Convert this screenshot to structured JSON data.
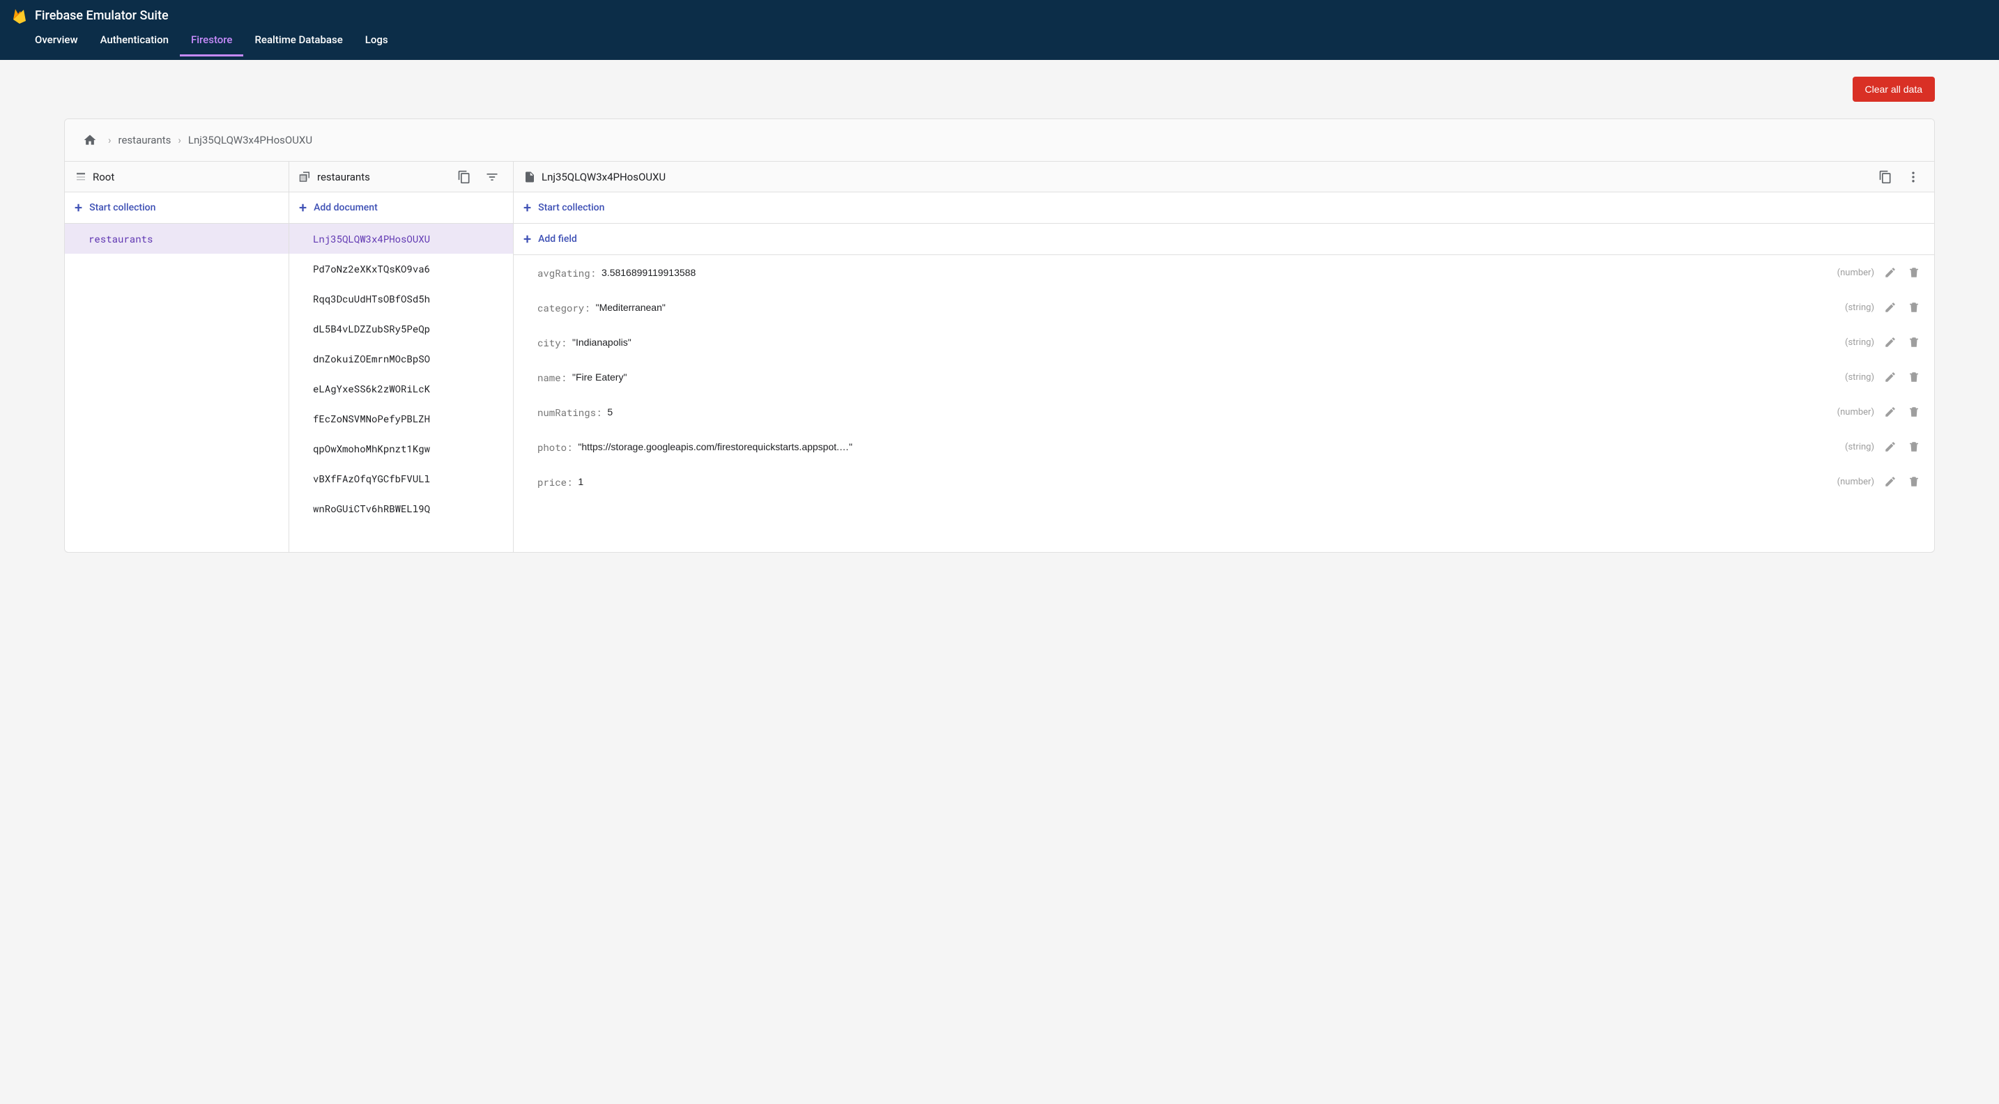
{
  "header": {
    "title": "Firebase Emulator Suite",
    "tabs": [
      {
        "label": "Overview",
        "active": false
      },
      {
        "label": "Authentication",
        "active": false
      },
      {
        "label": "Firestore",
        "active": true
      },
      {
        "label": "Realtime Database",
        "active": false
      },
      {
        "label": "Logs",
        "active": false
      }
    ]
  },
  "clear_button_label": "Clear all data",
  "breadcrumb": {
    "segments": [
      "restaurants",
      "Lnj35QLQW3x4PHosOUXU"
    ]
  },
  "columns": {
    "root": {
      "title": "Root",
      "action": "Start collection",
      "items": [
        {
          "id": "restaurants",
          "selected": true
        }
      ]
    },
    "collection": {
      "title": "restaurants",
      "action": "Add document",
      "items": [
        {
          "id": "Lnj35QLQW3x4PHosOUXU",
          "selected": true
        },
        {
          "id": "Pd7oNz2eXKxTQsKO9va6",
          "selected": false
        },
        {
          "id": "Rqq3DcuUdHTsOBfOSd5h",
          "selected": false
        },
        {
          "id": "dL5B4vLDZZubSRy5PeQp",
          "selected": false
        },
        {
          "id": "dnZokuiZOEmrnMOcBpSO",
          "selected": false
        },
        {
          "id": "eLAgYxeSS6k2zWORiLcK",
          "selected": false
        },
        {
          "id": "fEcZoNSVMNoPefyPBLZH",
          "selected": false
        },
        {
          "id": "qpOwXmohoMhKpnzt1Kgw",
          "selected": false
        },
        {
          "id": "vBXfFAzOfqYGCfbFVULl",
          "selected": false
        },
        {
          "id": "wnRoGUiCTv6hRBWELl9Q",
          "selected": false
        }
      ]
    },
    "document": {
      "title": "Lnj35QLQW3x4PHosOUXU",
      "action_collection": "Start collection",
      "action_field": "Add field",
      "fields": [
        {
          "key": "avgRating",
          "value": "3.5816899119913588",
          "type": "number",
          "quoted": false
        },
        {
          "key": "category",
          "value": "Mediterranean",
          "type": "string",
          "quoted": true
        },
        {
          "key": "city",
          "value": "Indianapolis",
          "type": "string",
          "quoted": true
        },
        {
          "key": "name",
          "value": "Fire Eatery",
          "type": "string",
          "quoted": true
        },
        {
          "key": "numRatings",
          "value": "5",
          "type": "number",
          "quoted": false
        },
        {
          "key": "photo",
          "value": "https://storage.googleapis.com/firestorequickstarts.appspot.…",
          "type": "string",
          "quoted": true
        },
        {
          "key": "price",
          "value": "1",
          "type": "number",
          "quoted": false
        }
      ]
    }
  }
}
